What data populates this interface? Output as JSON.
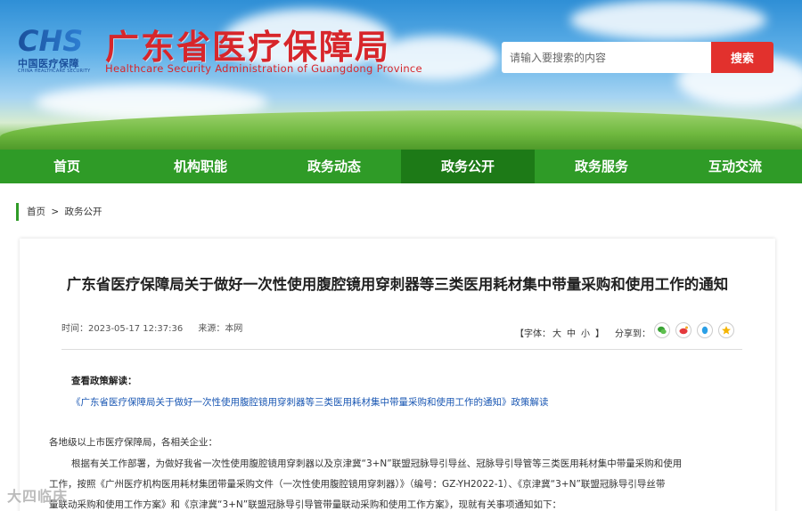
{
  "header": {
    "logo_letters": "CHS",
    "logo_cn": "中国医疗保障",
    "logo_en": "CHINA HEALTHCARE SECURITY",
    "site_title": "广东省医疗保障局",
    "site_subtitle": "Healthcare Security Administration of Guangdong Province"
  },
  "search": {
    "placeholder": "请输入要搜索的内容",
    "button_label": "搜索"
  },
  "nav": {
    "items": [
      {
        "label": "首页"
      },
      {
        "label": "机构职能"
      },
      {
        "label": "政务动态"
      },
      {
        "label": "政务公开"
      },
      {
        "label": "政务服务"
      },
      {
        "label": "互动交流"
      }
    ],
    "active_index": 3
  },
  "breadcrumb": {
    "home": "首页",
    "separator": ">",
    "current": "政务公开"
  },
  "article": {
    "title": "广东省医疗保障局关于做好一次性使用腹腔镜用穿刺器等三类医用耗材集中带量采购和使用工作的通知",
    "time": "时间：2023-05-17 12:37:36",
    "source": "来源：本网",
    "font_size_label": "【字体：",
    "font_large": "大",
    "font_medium": "中",
    "font_small": "小",
    "font_size_close": "】",
    "share_label": "分享到：",
    "interp_heading": "查看政策解读：",
    "interp_link": "《广东省医疗保障局关于做好一次性使用腹腔镜用穿刺器等三类医用耗材集中带量采购和使用工作的通知》政策解读",
    "para1": "各地级以上市医疗保障局，各相关企业：",
    "para2": "根据有关工作部署，为做好我省一次性使用腹腔镜用穿刺器以及京津冀“3+N”联盟冠脉导引导丝、冠脉导引导管等三类医用耗材集中带量采购和使用",
    "para3": "工作，按照《广州医疗机构医用耗材集团带量采购文件（一次性使用腹腔镜用穿刺器）》（编号：GZ-YH2022-1）、《京津冀“3+N”联盟冠脉导引导丝带",
    "para4": "量联动采购和使用工作方案》和《京津冀“3+N”联盟冠脉导引导管带量联动采购和使用工作方案》，现就有关事项通知如下："
  },
  "share_icons": [
    "wechat-icon",
    "weibo-icon",
    "qq-icon",
    "qzone-icon"
  ],
  "watermark": "大四临床",
  "colors": {
    "title_red": "#d7262b",
    "nav_green": "#2f9b27",
    "nav_active": "#1d7a17",
    "search_red": "#e2312d",
    "link_blue": "#1a57b3"
  }
}
